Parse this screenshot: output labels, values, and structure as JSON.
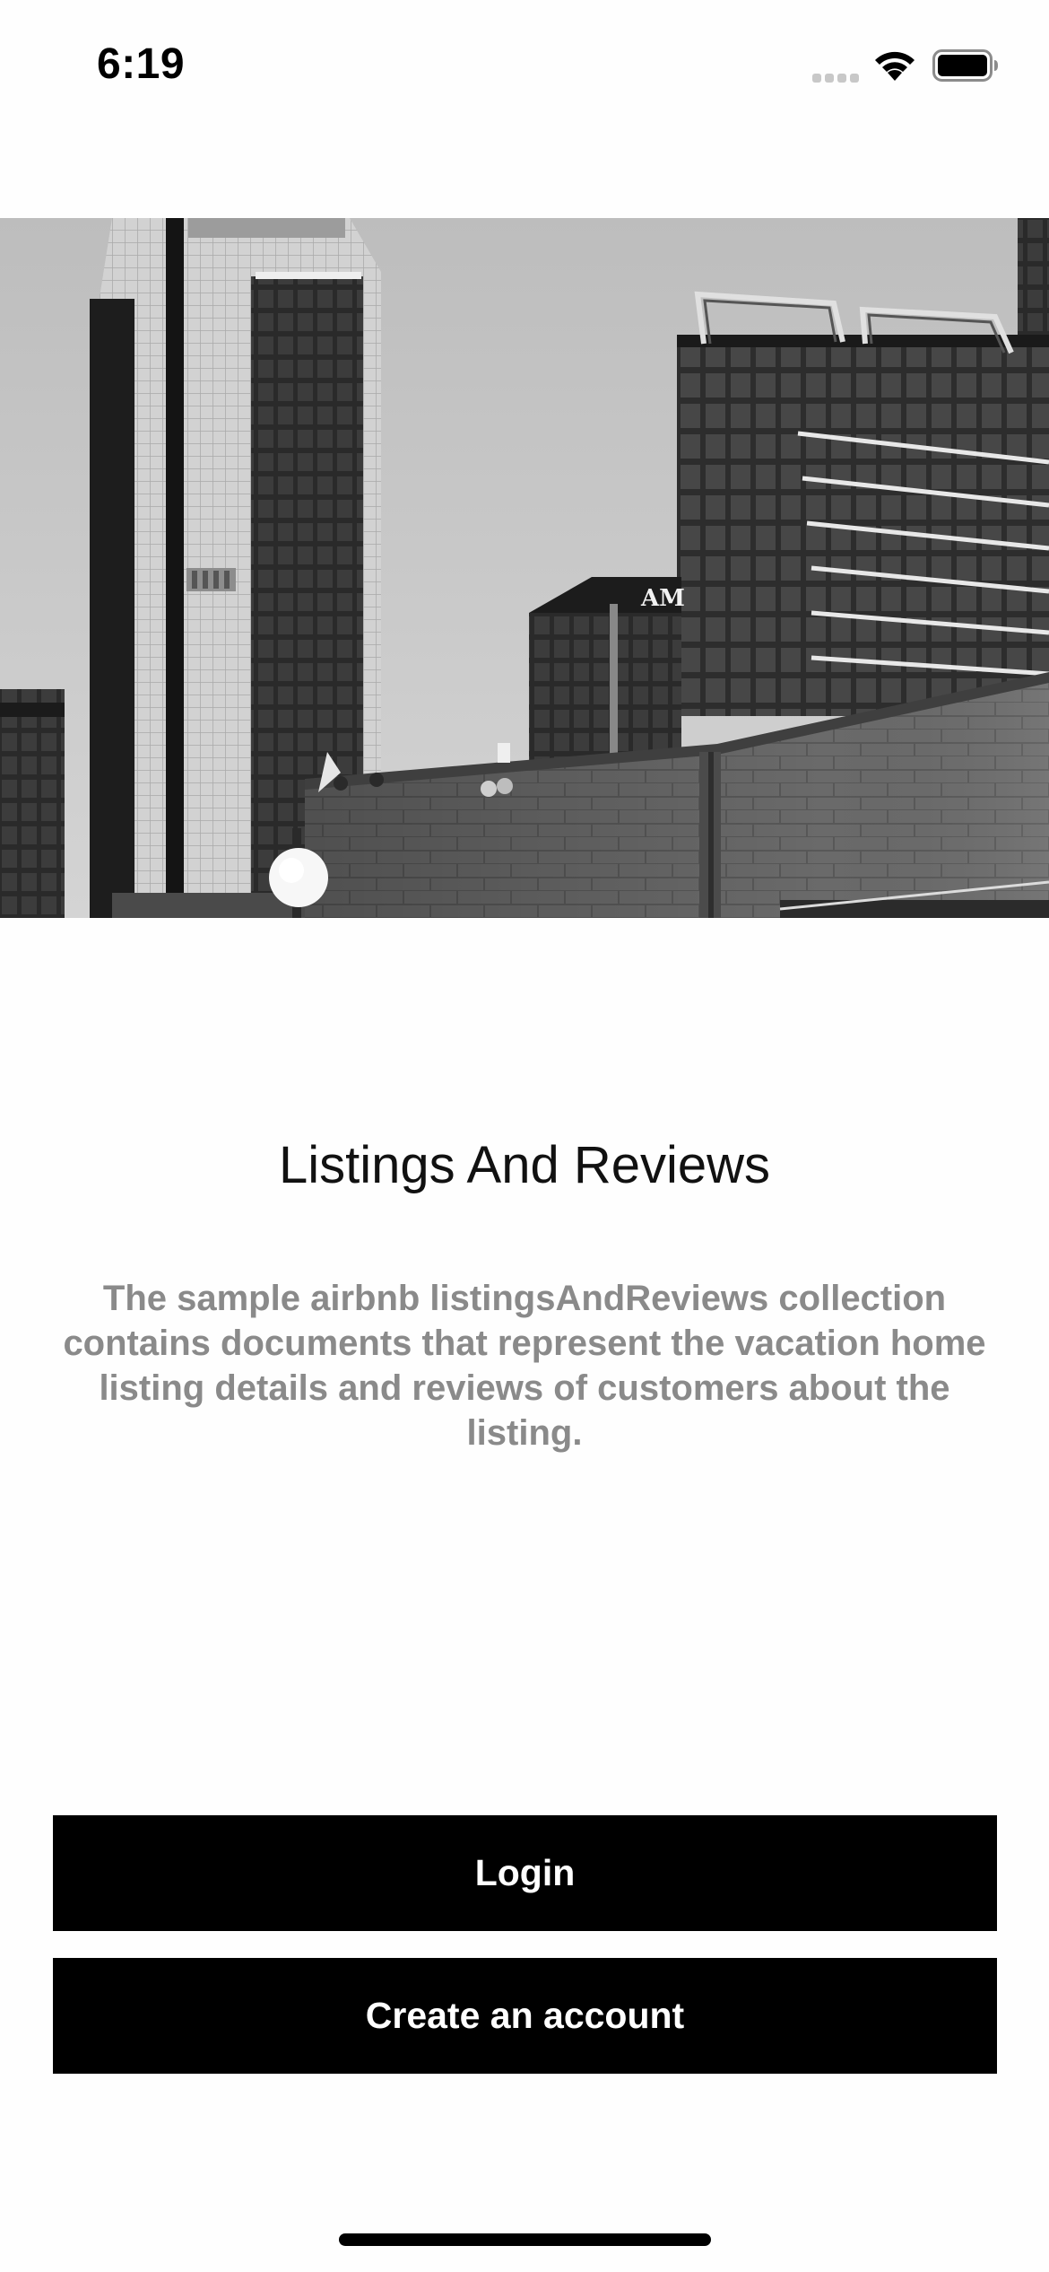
{
  "status_bar": {
    "time": "6:19",
    "icons": [
      "signal-icon",
      "wifi-icon",
      "battery-icon"
    ]
  },
  "hero": {
    "image": "city-buildings-photo",
    "sign_text": "AM"
  },
  "main": {
    "title": "Listings And Reviews",
    "description": "The sample airbnb listingsAndReviews collection contains documents that represent the vacation home listing details and reviews of customers about the listing."
  },
  "actions": {
    "login_label": "Login",
    "create_account_label": "Create an account"
  },
  "colors": {
    "button_bg": "#000000",
    "button_text": "#ffffff",
    "description_text": "#8a8a8a",
    "background": "#fefefe"
  }
}
